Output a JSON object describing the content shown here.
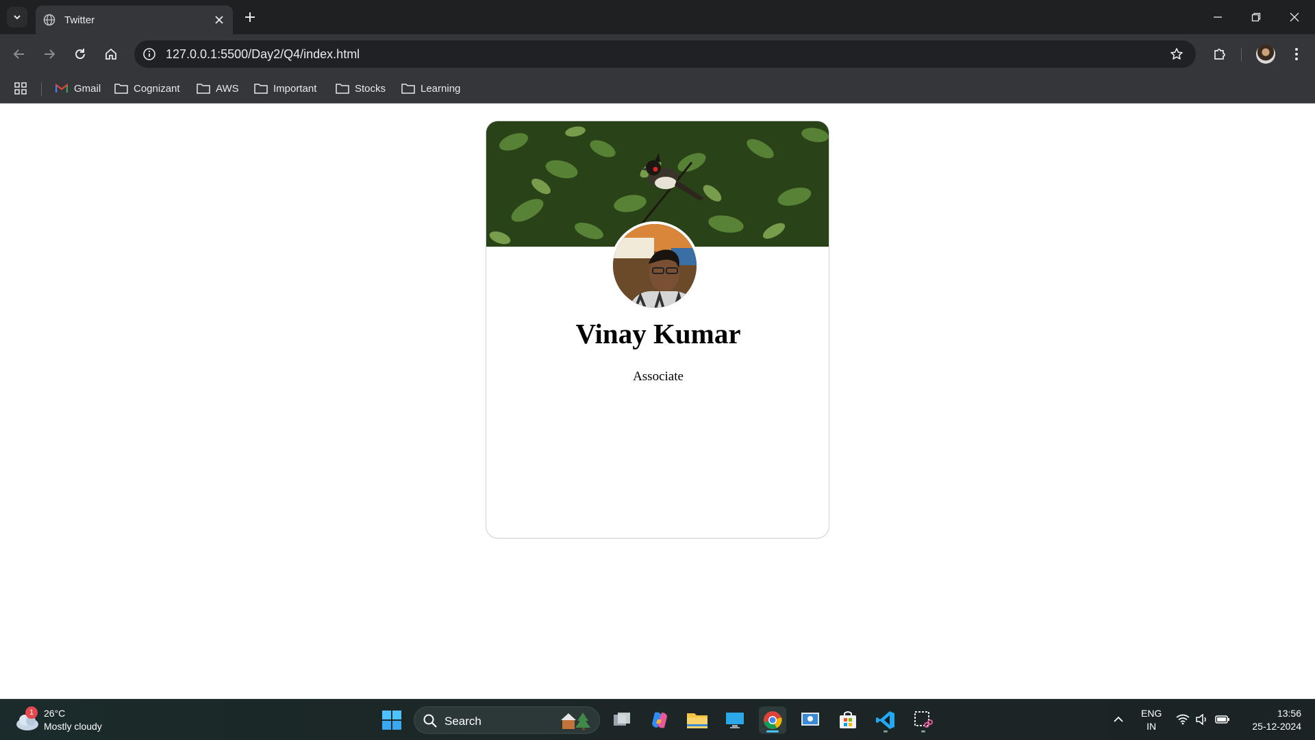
{
  "browser": {
    "tab_title": "Twitter",
    "url": "127.0.0.1:5500/Day2/Q4/index.html",
    "bookmarks": [
      {
        "label": "Gmail",
        "icon": "gmail-icon"
      },
      {
        "label": "Cognizant",
        "icon": "folder-icon"
      },
      {
        "label": "AWS",
        "icon": "folder-icon"
      },
      {
        "label": "Important",
        "icon": "folder-icon"
      },
      {
        "label": "Stocks",
        "icon": "folder-icon"
      },
      {
        "label": "Learning",
        "icon": "folder-icon"
      }
    ]
  },
  "profile": {
    "name": "Vinay Kumar",
    "role": "Associate"
  },
  "taskbar": {
    "weather": {
      "badge": "1",
      "temperature": "26°C",
      "condition": "Mostly cloudy"
    },
    "search_label": "Search",
    "language": {
      "line1": "ENG",
      "line2": "IN"
    },
    "time": "13:56",
    "date": "25-12-2024"
  },
  "colors": {
    "chrome_dark": "#1f2021",
    "chrome_toolbar": "#35363a",
    "taskbar": "#1c2626",
    "accent": "#4cc2ff"
  }
}
